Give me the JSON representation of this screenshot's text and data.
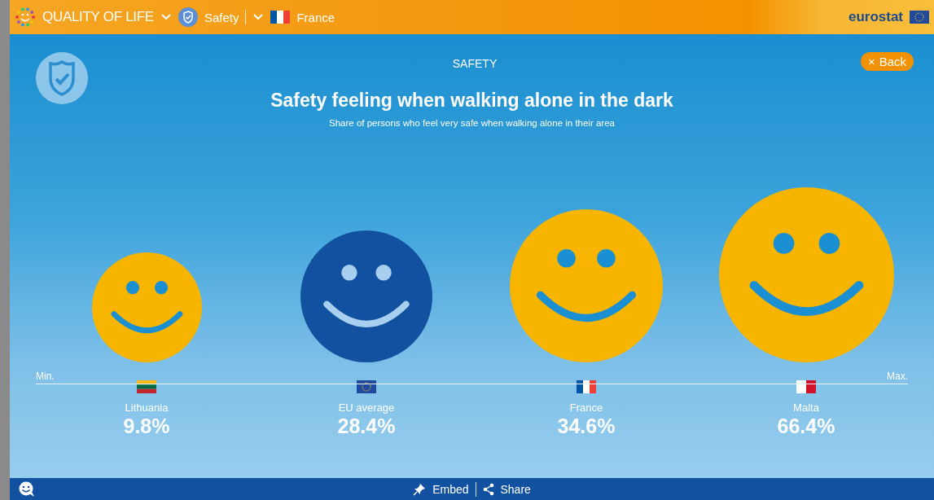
{
  "header": {
    "app_title": "QUALITY OF LIFE",
    "topic": "Safety",
    "country": "France",
    "brand": "eurostat"
  },
  "section": "SAFETY",
  "back_button": {
    "icon": "×",
    "label": "Back"
  },
  "title": "Safety feeling when walking alone in the dark",
  "subtitle": "Share of persons who feel very safe when walking alone in their area",
  "scale": {
    "min_label": "Min.",
    "max_label": "Max."
  },
  "items": [
    {
      "name": "Lithuania",
      "value": "9.8%",
      "kind": "lithuania",
      "color": "#f7b500"
    },
    {
      "name": "EU average",
      "value": "28.4%",
      "kind": "eu",
      "color": "#12519f"
    },
    {
      "name": "France",
      "value": "34.6%",
      "kind": "france",
      "color": "#f7b500"
    },
    {
      "name": "Malta",
      "value": "66.4%",
      "kind": "malta",
      "color": "#f7b500"
    }
  ],
  "footer": {
    "embed": "Embed",
    "share": "Share"
  }
}
